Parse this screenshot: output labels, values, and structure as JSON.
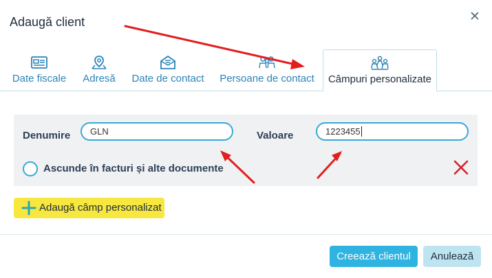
{
  "dialog": {
    "title": "Adaugă client",
    "close_icon": "close-icon"
  },
  "tabs": [
    {
      "label": "Date fiscale",
      "icon": "fiscal-card-icon",
      "active": false
    },
    {
      "label": "Adresă",
      "icon": "map-pin-icon",
      "active": false
    },
    {
      "label": "Date de contact",
      "icon": "envelope-icon",
      "active": false
    },
    {
      "label": "Persoane de contact",
      "icon": "people-icon",
      "active": false
    },
    {
      "label": "Câmpuri personalizate",
      "icon": "group-icon",
      "active": true
    }
  ],
  "custom_field": {
    "name_label": "Denumire",
    "name_value": "GLN",
    "value_label": "Valoare",
    "value_value": "1223455",
    "hide_label": "Ascunde în facturi și alte documente",
    "hide_checked": false
  },
  "add_field_button": "Adaugă câmp personalizat",
  "footer": {
    "create_button": "Creează clientul",
    "cancel_button": "Anulează"
  },
  "colors": {
    "accent": "#2fb3e0",
    "tab_text": "#2a83b7",
    "input_border": "#36a9d6",
    "add_button_bg": "#f8e73e",
    "delete": "#d6202a",
    "annotation_arrow": "#e21e1e"
  }
}
